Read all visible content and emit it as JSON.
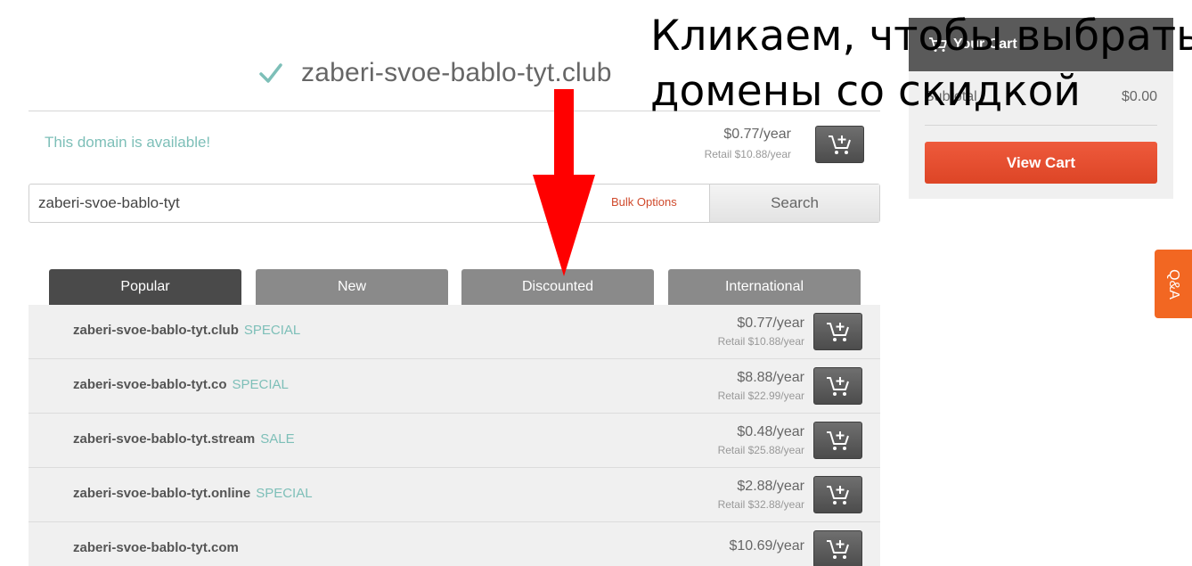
{
  "header": {
    "checked_domain": "zaberi-svoe-bablo-tyt.club",
    "availability_text": "This domain is available!",
    "price": "$0.77/year",
    "retail": "Retail $10.88/year"
  },
  "search": {
    "value": "zaberi-svoe-bablo-tyt",
    "bulk_options_label": "Bulk Options",
    "button_label": "Search"
  },
  "tabs": [
    {
      "label": "Popular",
      "active": true
    },
    {
      "label": "New",
      "active": false
    },
    {
      "label": "Discounted",
      "active": false
    },
    {
      "label": "International",
      "active": false
    }
  ],
  "results": [
    {
      "domain": "zaberi-svoe-bablo-tyt.club",
      "tag": "SPECIAL",
      "price": "$0.77/year",
      "retail": "Retail $10.88/year"
    },
    {
      "domain": "zaberi-svoe-bablo-tyt.co",
      "tag": "SPECIAL",
      "price": "$8.88/year",
      "retail": "Retail $22.99/year"
    },
    {
      "domain": "zaberi-svoe-bablo-tyt.stream",
      "tag": "SALE",
      "price": "$0.48/year",
      "retail": "Retail $25.88/year"
    },
    {
      "domain": "zaberi-svoe-bablo-tyt.online",
      "tag": "SPECIAL",
      "price": "$2.88/year",
      "retail": "Retail $32.88/year"
    },
    {
      "domain": "zaberi-svoe-bablo-tyt.com",
      "tag": "",
      "price": "$10.69/year",
      "retail": ""
    }
  ],
  "cart": {
    "title": "Your Cart",
    "subtotal_label": "Subtotal",
    "subtotal_value": "$0.00",
    "view_cart_label": "View Cart"
  },
  "qa_label": "Q&A",
  "annotation": {
    "line1": "Кликаем, чтобы выбрать",
    "line2": "домены со скидкой"
  },
  "colors": {
    "accent_orange": "#ee5a3c",
    "tag_teal": "#7dbfb8",
    "tab_active": "#4a4a4a",
    "tab_inactive": "#8a8a8a",
    "arrow_red": "#ff0000"
  },
  "icons": [
    "check-icon",
    "add-to-cart-icon",
    "cart-icon"
  ]
}
